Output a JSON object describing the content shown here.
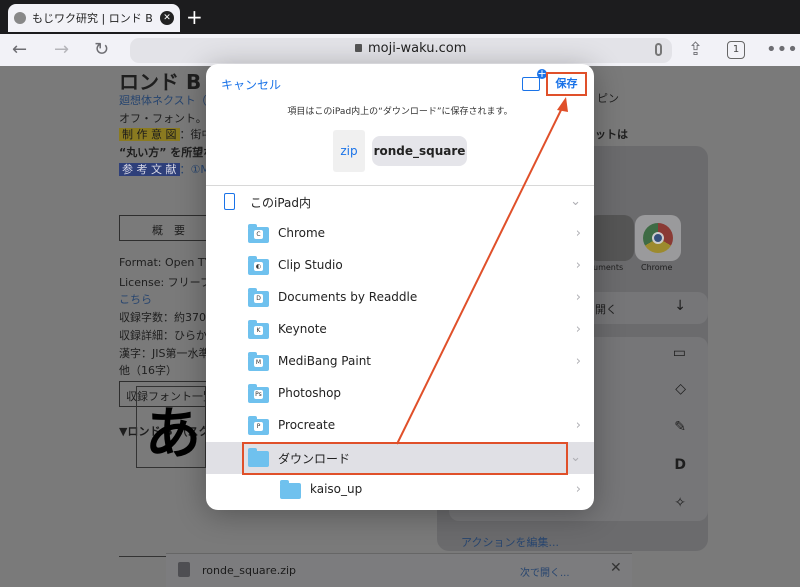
{
  "browser": {
    "tab_title": "もじワク研究 | ロンド B （ス",
    "url": "moji-waku.com",
    "tab_count": "1"
  },
  "page": {
    "heading": "ロンド B",
    "link1": "廻想体ネクスト（",
    "line_of": "オフ・フォント。",
    "tag_intent": "制 作 意 図",
    "intent_text": "：街中",
    "maru": "“丸い方” を所望な",
    "tag_ref": "参 考 文 献",
    "ref_text": "：①MI",
    "overview_btn": "概　要",
    "format": "Format: Open TY",
    "license": "License: フリーフ",
    "kochira": "こちら",
    "chars": "収録字数：約370",
    "detail": "収録詳細：ひらか",
    "kanji": "漢字：JIS第一水準",
    "other": "他（16字）",
    "list_btn": "収録フォント一覧",
    "sample_head": "▼ロンド B （スク",
    "right_text1": "ピン",
    "right_text2": "ットは",
    "sample_glyph": "あ"
  },
  "share_sheet": {
    "app_label_1": "uments",
    "app_label_2": "Chrome",
    "open_in": "開く",
    "edit_actions": "アクションを編集..."
  },
  "download_bar": {
    "filename": "ronde_square.zip",
    "open_next": "次で開く..."
  },
  "dialog": {
    "cancel": "キャンセル",
    "save": "保存",
    "info": "項目はこのiPad内上の“ダウンロード”に保存されます。",
    "file_type": "zip",
    "file_name": "ronde_square",
    "location": "このiPad内",
    "folders": [
      {
        "label": "Chrome",
        "badge": "C"
      },
      {
        "label": "Clip Studio",
        "badge": "◐"
      },
      {
        "label": "Documents by Readdle",
        "badge": "D"
      },
      {
        "label": "Keynote",
        "badge": "K"
      },
      {
        "label": "MediBang Paint",
        "badge": "M"
      },
      {
        "label": "Photoshop",
        "badge": "Ps"
      },
      {
        "label": "Procreate",
        "badge": "P"
      }
    ],
    "selected_folder": "ダウンロード",
    "subfolder": "kaiso_up"
  },
  "colors": {
    "accent": "#1a73e8",
    "annotation": "#e0502a"
  }
}
